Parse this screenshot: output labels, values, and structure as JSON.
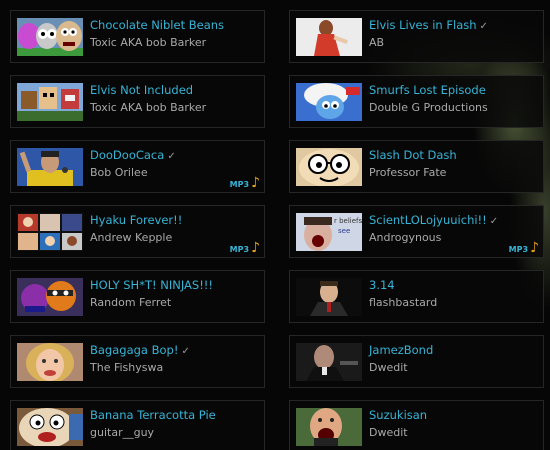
{
  "columns": [
    [
      {
        "title": "Chocolate Niblet Beans",
        "author": "Toxic AKA bob Barker",
        "checked": false,
        "mp3": false,
        "thumb": "cartoon-faces-thumb"
      },
      {
        "title": "Elvis Not Included",
        "author": "Toxic AKA bob Barker",
        "checked": false,
        "mp3": false,
        "thumb": "pixel-cartoon-thumb"
      },
      {
        "title": "DooDooCaca",
        "author": "Bob Orilee",
        "checked": true,
        "mp3": true,
        "thumb": "singer-photo-thumb"
      },
      {
        "title": "Hyaku Forever!!",
        "author": "Andrew Kepple",
        "checked": false,
        "mp3": true,
        "thumb": "anime-grid-thumb"
      },
      {
        "title": "HOLY SH*T! NINJAS!!!",
        "author": "Random Ferret",
        "checked": false,
        "mp3": false,
        "thumb": "ninja-cartoon-thumb"
      },
      {
        "title": "Bagagaga Bop!",
        "author": "The Fishyswa",
        "checked": true,
        "mp3": false,
        "thumb": "blonde-singer-thumb"
      },
      {
        "title": "Banana Terracotta Pie",
        "author": "guitar__guy",
        "checked": false,
        "mp3": false,
        "thumb": "cartoon-face-closeup-thumb"
      }
    ],
    [
      {
        "title": "Elvis Lives in Flash",
        "author": "AB",
        "checked": true,
        "mp3": false,
        "thumb": "red-dress-figure-thumb"
      },
      {
        "title": "Smurfs Lost Episode",
        "author": "Double G Productions",
        "checked": false,
        "mp3": false,
        "thumb": "smurf-thumb"
      },
      {
        "title": "Slash Dot Dash",
        "author": "Professor Fate",
        "checked": false,
        "mp3": false,
        "thumb": "glasses-cartoon-thumb"
      },
      {
        "title": "ScientLOLojyuuichi!!",
        "author": "Androgynous",
        "checked": true,
        "mp3": true,
        "thumb": "screaming-face-text-thumb"
      },
      {
        "title": "3.14",
        "author": "flashbastard",
        "checked": false,
        "mp3": false,
        "thumb": "man-suit-dark-thumb"
      },
      {
        "title": "JamezBond",
        "author": "Dwedit",
        "checked": false,
        "mp3": false,
        "thumb": "bond-photo-thumb"
      },
      {
        "title": "Suzukisan",
        "author": "Dwedit",
        "checked": false,
        "mp3": false,
        "thumb": "shouting-man-thumb"
      }
    ]
  ],
  "labels": {
    "mp3": "MP3",
    "check": "✓",
    "note": "♪"
  },
  "thumb_extras": {
    "screaming-face-text": {
      "line1": "r beliefs",
      "line2": "see"
    }
  },
  "colors": {
    "title": "#37b4d6",
    "author": "#a9a9a9",
    "border": "#262626",
    "background": "#060606",
    "mp3_note": "#e8a21a"
  }
}
